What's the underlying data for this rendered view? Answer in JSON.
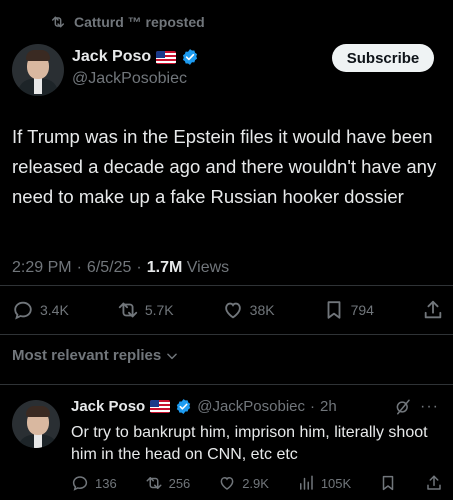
{
  "repost": {
    "text": "Catturd ™ reposted"
  },
  "author": {
    "name": "Jack Poso",
    "handle": "@JackPosobiec",
    "subscribe_label": "Subscribe"
  },
  "post": {
    "text": "If Trump was in the Epstein files it would have been released a decade ago and there wouldn't have any need to make up a fake Russian hooker dossier",
    "time": "2:29 PM",
    "date": "6/5/25",
    "views_count": "1.7M",
    "views_label": "Views"
  },
  "stats": {
    "replies": "3.4K",
    "reposts": "5.7K",
    "likes": "38K",
    "bookmarks": "794"
  },
  "sort": {
    "label": "Most relevant replies"
  },
  "reply": {
    "name": "Jack Poso",
    "handle": "@JackPosobiec",
    "time": "2h",
    "text": "Or try to bankrupt him, imprison him, literally shoot him in the head on CNN, etc etc",
    "replies": "136",
    "reposts": "256",
    "likes": "2.9K",
    "views": "105K"
  },
  "colors": {
    "background": "#000000",
    "text": "#e7e9ea",
    "muted": "#71767b",
    "verified": "#1d9bf0",
    "divider": "#2f3336"
  }
}
